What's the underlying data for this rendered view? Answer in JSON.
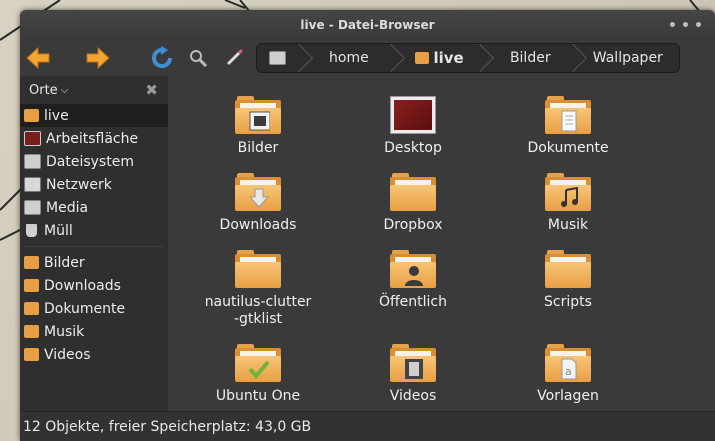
{
  "window": {
    "title": "live - Datei-Browser"
  },
  "pathbar": {
    "crumbs": [
      "home",
      "live",
      "Bilder",
      "Wallpaper"
    ]
  },
  "sidebar": {
    "header": "Orte",
    "places": [
      {
        "label": "live",
        "icon": "home-folder-icon"
      },
      {
        "label": "Arbeitsfläche",
        "icon": "desktop-icon"
      },
      {
        "label": "Dateisystem",
        "icon": "drive-icon"
      },
      {
        "label": "Netzwerk",
        "icon": "network-icon"
      },
      {
        "label": "Media",
        "icon": "drive-icon"
      },
      {
        "label": "Müll",
        "icon": "trash-icon"
      }
    ],
    "bookmarks": [
      {
        "label": "Bilder",
        "icon": "pictures-folder-icon"
      },
      {
        "label": "Downloads",
        "icon": "downloads-folder-icon"
      },
      {
        "label": "Dokumente",
        "icon": "documents-folder-icon"
      },
      {
        "label": "Musik",
        "icon": "music-folder-icon"
      },
      {
        "label": "Videos",
        "icon": "videos-folder-icon"
      }
    ]
  },
  "files": [
    {
      "label": "Bilder",
      "icon": "pictures-folder-icon"
    },
    {
      "label": "Desktop",
      "icon": "desktop-icon"
    },
    {
      "label": "Dokumente",
      "icon": "documents-folder-icon"
    },
    {
      "label": "Downloads",
      "icon": "downloads-folder-icon"
    },
    {
      "label": "Dropbox",
      "icon": "folder-icon"
    },
    {
      "label": "Musik",
      "icon": "music-folder-icon"
    },
    {
      "label": "nautilus-clutter-gtklist",
      "icon": "folder-icon"
    },
    {
      "label": "Öffentlich",
      "icon": "public-folder-icon"
    },
    {
      "label": "Scripts",
      "icon": "folder-icon"
    },
    {
      "label": "Ubuntu One",
      "icon": "ubuntuone-folder-icon"
    },
    {
      "label": "Videos",
      "icon": "videos-folder-icon"
    },
    {
      "label": "Vorlagen",
      "icon": "templates-folder-icon"
    }
  ],
  "status": {
    "text": "12 Objekte, freier Speicherplatz: 43,0 GB"
  },
  "colors": {
    "accent": "#f3a531",
    "folder": "#e89f43",
    "window": "#3a3a3a"
  }
}
